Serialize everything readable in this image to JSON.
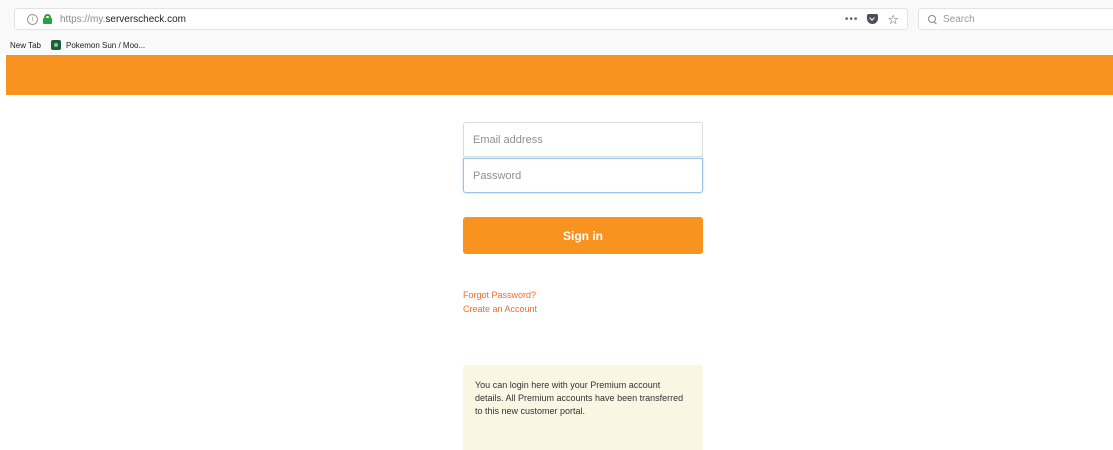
{
  "browser": {
    "url_scheme": "https://my.",
    "url_host": "serverscheck.com",
    "more_icon": "•••",
    "star_icon": "☆",
    "info_icon": "i",
    "search_placeholder": "Search",
    "bookmarks": [
      {
        "label": "New Tab"
      },
      {
        "label": "Pokemon Sun / Moo..."
      }
    ]
  },
  "brand": {
    "header_color": "#f7931e"
  },
  "login": {
    "email_placeholder": "Email address",
    "password_placeholder": "Password",
    "email_value": "",
    "password_value": "",
    "signin_label": "Sign in",
    "forgot_password_label": "Forgot Password?",
    "create_account_label": "Create an Account"
  },
  "notice": {
    "text": "You can login here with your Premium account details. All Premium accounts have been transferred to this new customer portal."
  }
}
